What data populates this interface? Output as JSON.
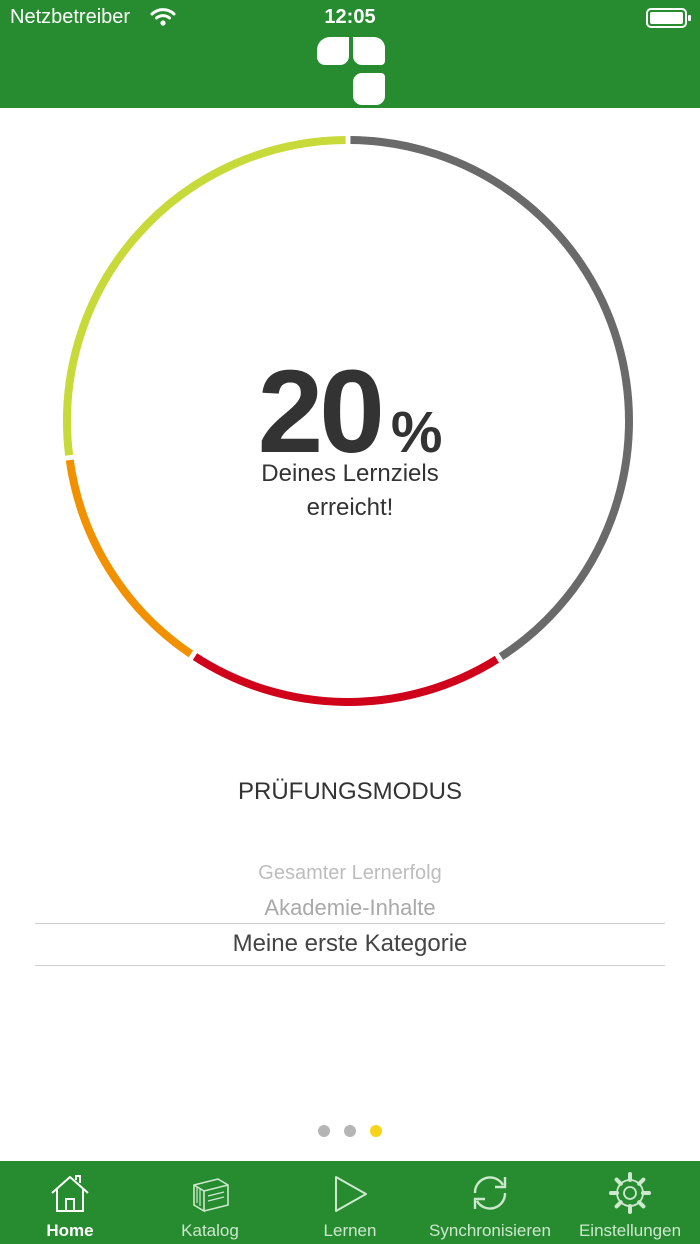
{
  "status_bar": {
    "carrier": "Netzbetreiber",
    "time": "12:05"
  },
  "gauge": {
    "value": "20",
    "unit": "%",
    "caption_line1": "Deines Lernziels",
    "caption_line2": "erreicht!",
    "segment_colors": [
      "#c8d93a",
      "#f29100",
      "#d0021b",
      "#6a6a6a"
    ]
  },
  "mode": {
    "title": "PRÜFUNGSMODUS"
  },
  "picker": {
    "items": [
      "Gesamter Lernerfolg",
      "Akademie-Inhalte",
      "Meine erste Kategorie"
    ],
    "selected": "Meine erste Kategorie"
  },
  "page_indicator": {
    "count": 3,
    "active": 3
  },
  "tabs": [
    {
      "label": "Home",
      "icon": "home-icon",
      "active": true
    },
    {
      "label": "Katalog",
      "icon": "books-icon",
      "active": false
    },
    {
      "label": "Lernen",
      "icon": "play-icon",
      "active": false
    },
    {
      "label": "Synchronisieren",
      "icon": "sync-icon",
      "active": false
    },
    {
      "label": "Einstellungen",
      "icon": "gear-icon",
      "active": false
    }
  ],
  "colors": {
    "brand_green": "#278b2f",
    "indicator_active": "#f4d51a"
  }
}
